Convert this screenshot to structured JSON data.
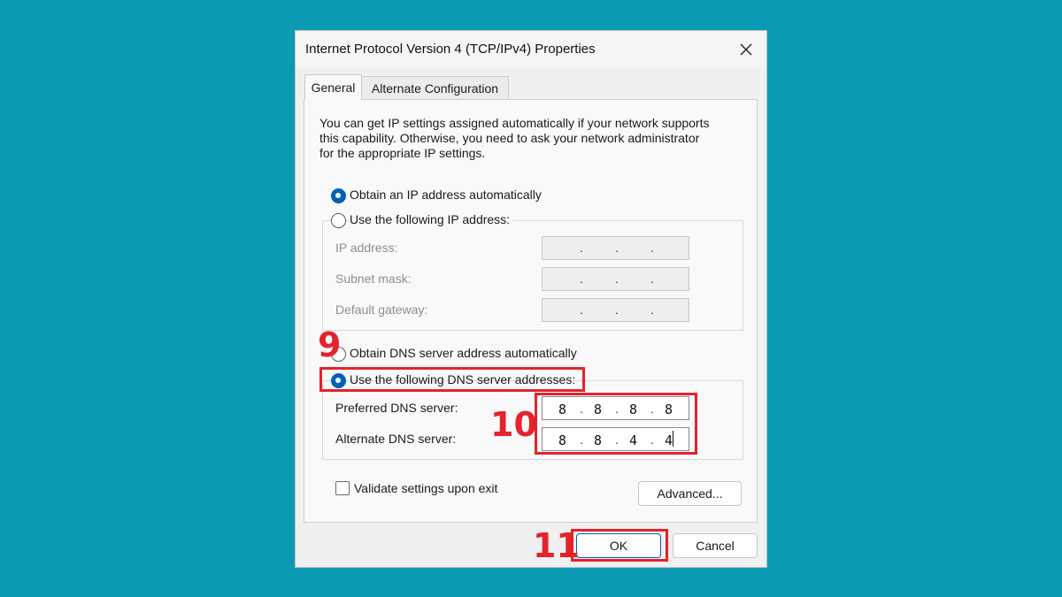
{
  "dialog": {
    "title": "Internet Protocol Version 4 (TCP/IPv4) Properties"
  },
  "tabs": [
    {
      "label": "General",
      "selected": true
    },
    {
      "label": "Alternate Configuration",
      "selected": false
    }
  ],
  "intro": {
    "line1": "You can get IP settings assigned automatically if your network supports",
    "line2": "this capability. Otherwise, you need to ask your network administrator",
    "line3": "for the appropriate IP settings."
  },
  "ip_options": {
    "auto_label": "Obtain an IP address automatically",
    "manual_label": "Use the following IP address:",
    "selected": "auto"
  },
  "ip_fields": {
    "ip_label": "IP address:",
    "subnet_label": "Subnet mask:",
    "gateway_label": "Default gateway:",
    "placeholder_dots": ".    .    ."
  },
  "dns_options": {
    "auto_label": "Obtain DNS server address automatically",
    "manual_label": "Use the following DNS server addresses:",
    "selected": "manual"
  },
  "dns_fields": {
    "preferred_label": "Preferred DNS server:",
    "preferred_octets": [
      "8",
      "8",
      "8",
      "8"
    ],
    "alternate_label": "Alternate DNS server:",
    "alternate_octets": [
      "8",
      "8",
      "4",
      "4"
    ]
  },
  "validate": {
    "label": "Validate settings upon exit",
    "checked": false
  },
  "buttons": {
    "advanced": "Advanced...",
    "ok": "OK",
    "cancel": "Cancel"
  },
  "annotations": {
    "step9": "9",
    "step10": "10",
    "step11": "11",
    "color": "#e4232c"
  }
}
